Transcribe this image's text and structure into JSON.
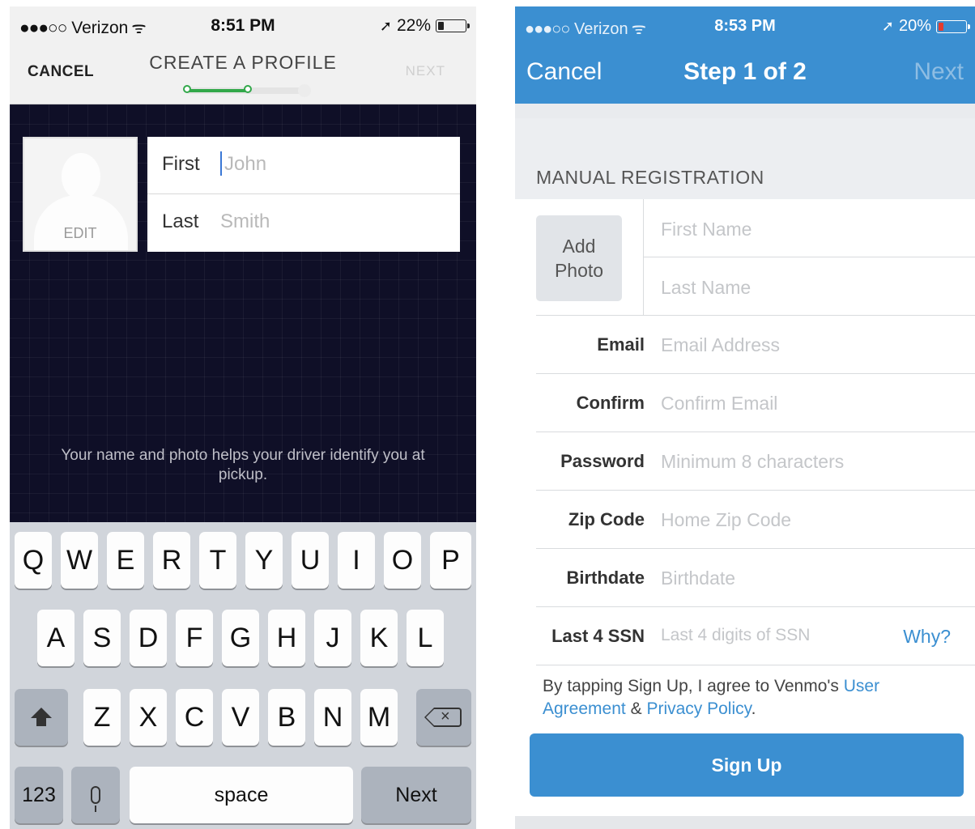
{
  "left": {
    "status": {
      "carrier": "Verizon",
      "time": "8:51 PM",
      "battery": "22%",
      "battery_level": 0.22
    },
    "nav": {
      "cancel": "CANCEL",
      "title": "CREATE A PROFILE",
      "next": "NEXT",
      "progress_step": 1,
      "progress_total": 2
    },
    "photo": {
      "edit": "EDIT"
    },
    "fields": {
      "first_label": "First",
      "first_placeholder": "John",
      "last_label": "Last",
      "last_placeholder": "Smith"
    },
    "helper_text": "Your name and photo helps your driver identify you at pickup.",
    "keyboard": {
      "row1": [
        "Q",
        "W",
        "E",
        "R",
        "T",
        "Y",
        "U",
        "I",
        "O",
        "P"
      ],
      "row2": [
        "A",
        "S",
        "D",
        "F",
        "G",
        "H",
        "J",
        "K",
        "L"
      ],
      "row3": [
        "Z",
        "X",
        "C",
        "V",
        "B",
        "N",
        "M"
      ],
      "numbers": "123",
      "space": "space",
      "next": "Next"
    }
  },
  "right": {
    "status": {
      "carrier": "Verizon",
      "time": "8:53 PM",
      "battery": "20%",
      "battery_level": 0.2
    },
    "nav": {
      "cancel": "Cancel",
      "title": "Step 1 of 2",
      "next": "Next"
    },
    "section_title": "MANUAL REGISTRATION",
    "add_photo": {
      "line1": "Add",
      "line2": "Photo"
    },
    "first_name_placeholder": "First Name",
    "last_name_placeholder": "Last Name",
    "rows": [
      {
        "label": "Email",
        "placeholder": "Email Address"
      },
      {
        "label": "Confirm",
        "placeholder": "Confirm Email"
      },
      {
        "label": "Password",
        "placeholder": "Minimum 8 characters"
      },
      {
        "label": "Zip Code",
        "placeholder": "Home Zip Code"
      },
      {
        "label": "Birthdate",
        "placeholder": "Birthdate"
      },
      {
        "label": "Last 4 SSN",
        "placeholder": "Last 4 digits of SSN"
      }
    ],
    "why_link": "Why?",
    "legal": {
      "prefix": "By tapping Sign Up, I agree to Venmo's",
      "user_agreement": "User Agreement",
      "amp": "&",
      "privacy": "Privacy Policy",
      "suffix": "."
    },
    "signup_button": "Sign Up",
    "colors": {
      "accent": "#3b8fd1",
      "progress_green": "#32a84a",
      "battery_low": "#e33b2f"
    }
  }
}
